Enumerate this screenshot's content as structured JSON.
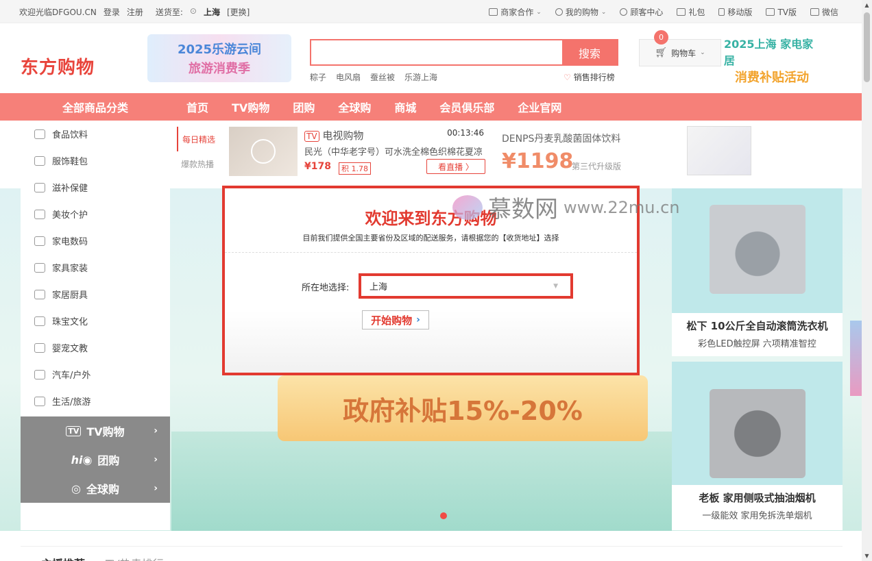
{
  "topbar": {
    "welcome": "欢迎光临DFGOU.CN",
    "login": "登录",
    "register": "注册",
    "ship_to": "送货至:",
    "city": "上海",
    "change": "[更换]",
    "links": [
      {
        "label": "商家合作",
        "caret": "⌄"
      },
      {
        "label": "我的购物",
        "caret": "⌄"
      },
      {
        "label": "顾客中心",
        "caret": ""
      },
      {
        "label": "礼包",
        "caret": ""
      },
      {
        "label": "移动版",
        "caret": ""
      },
      {
        "label": "TV版",
        "caret": ""
      },
      {
        "label": "微信",
        "caret": ""
      }
    ]
  },
  "header": {
    "logo": "东方购物",
    "ad_left_line1": "2025乐游云间",
    "ad_left_line2": "旅游消费季",
    "search_placeholder": "",
    "search_button": "搜索",
    "hotwords": [
      "粽子",
      "电风扇",
      "蚕丝被",
      "乐游上海"
    ],
    "rank_label": "销售排行榜",
    "cart_label": "购物车",
    "cart_count": "0",
    "ad_right_line1": "2025上海 家电家居",
    "ad_right_line2": "消费补贴活动"
  },
  "nav": {
    "all_categories": "全部商品分类",
    "links": [
      "首页",
      "TV购物",
      "团购",
      "全球购",
      "商城",
      "会员俱乐部",
      "企业官网"
    ]
  },
  "sidebar": {
    "categories": [
      "食品饮料",
      "服饰鞋包",
      "滋补保健",
      "美妆个护",
      "家电数码",
      "家具家装",
      "家居厨具",
      "珠宝文化",
      "婴宠文教",
      "汽车/户外",
      "生活/旅游"
    ],
    "channels": [
      {
        "label": "TV购物",
        "arrow": "›"
      },
      {
        "label": "团购",
        "arrow": "›"
      },
      {
        "label": "全球购",
        "arrow": "›"
      }
    ]
  },
  "promo": {
    "tab_active": "每日精选",
    "tab_inactive": "爆款热播",
    "tv_title": "电视购物",
    "tv_time": "00:13:46",
    "tv_desc": "民光（中华老字号）可水洗全棉色织棉花夏凉",
    "tv_price": "¥178",
    "tv_points": "积 1.78",
    "tv_watch": "看直播 〉",
    "ad_title": "DENPS丹麦乳酸菌固体饮料",
    "ad_price": "¥1198",
    "ad_sub": "第三代升级版"
  },
  "banner": {
    "subsidy": "政府补贴15%-20%"
  },
  "modal": {
    "welcome": "欢迎来到东方购物",
    "subtitle": "目前我们提供全国主要省份及区域的配送服务，请根据您的【收货地址】选择",
    "location_label": "所在地选择:",
    "location_value": "上海",
    "start_button": "开始购物",
    "start_chevron": "›"
  },
  "watermark": {
    "brand": "慕数网",
    "url": "www.22mu.cn"
  },
  "products": [
    {
      "name": "松下 10公斤全自动滚筒洗衣机",
      "desc": "彩色LED触控屏 六项精准智控"
    },
    {
      "name": "老板 家用侧吸式抽油烟机",
      "desc": "一级能效 家用免拆洗单烟机"
    }
  ],
  "bottom_tabs": {
    "active": "主播推荐",
    "inactive": "TV热卖排行"
  },
  "colors": {
    "accent": "#f68079",
    "red": "#e23a30",
    "teal": "#bfe8ea"
  }
}
